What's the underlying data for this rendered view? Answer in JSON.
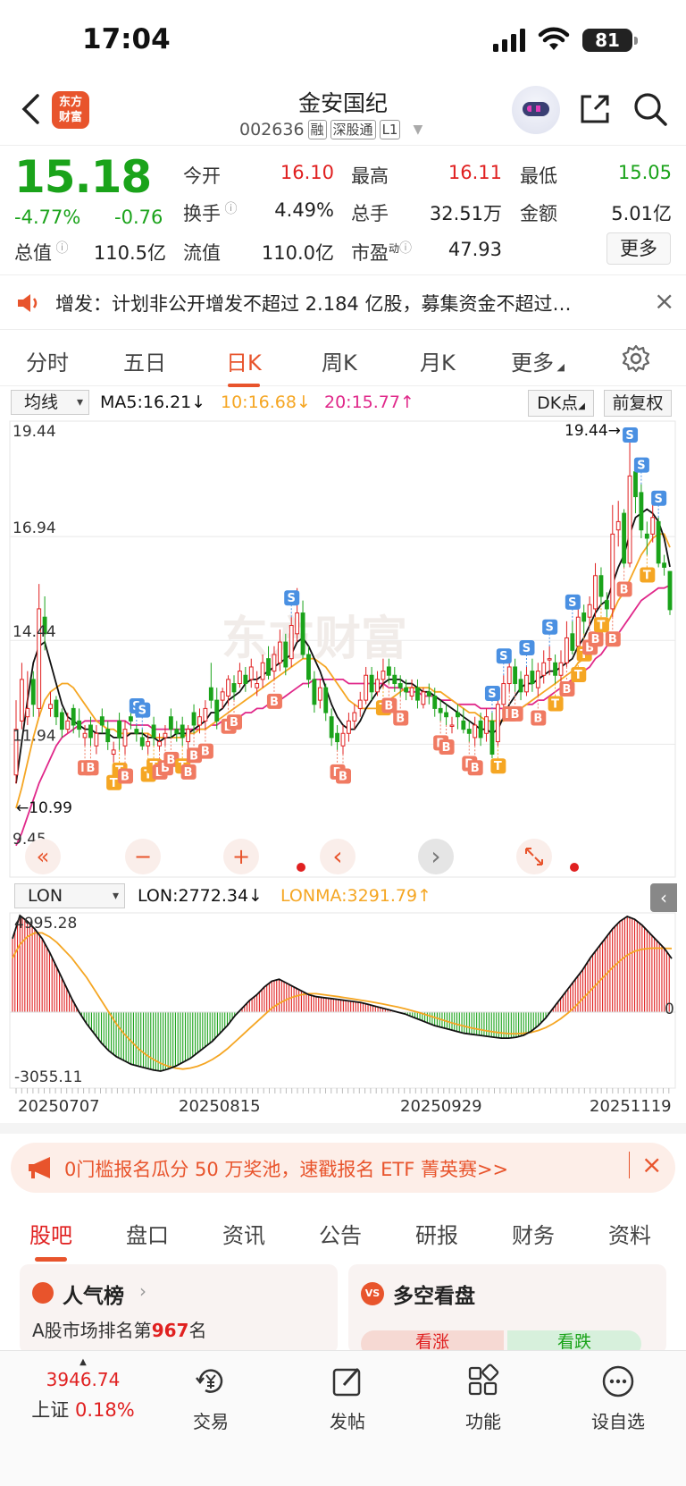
{
  "status": {
    "time": "17:04",
    "battery": "81"
  },
  "header": {
    "logo_text": "东方\n财富",
    "name": "金安国纪",
    "code": "002636",
    "tags": [
      "融",
      "深股通",
      "L1"
    ]
  },
  "quote": {
    "price": "15.18",
    "pct": "-4.77%",
    "chg": "-0.76",
    "open_label": "今开",
    "open": "16.10",
    "high_label": "最高",
    "high": "16.11",
    "low_label": "最低",
    "low": "15.05",
    "turnover_label": "换手",
    "turnover": "4.49%",
    "volume_label": "总手",
    "volume": "32.51万",
    "amount_label": "金额",
    "amount": "5.01亿",
    "mcap_label": "总值",
    "mcap": "110.5亿",
    "float_label": "流值",
    "float": "110.0亿",
    "pe_label": "市盈",
    "pe_sup": "动",
    "pe": "47.93",
    "more": "更多"
  },
  "notice": {
    "text": "增发：计划非公开增发不超过 2.184 亿股，募集资金不超过…",
    "close": "×"
  },
  "tabs": [
    "分时",
    "五日",
    "日K",
    "周K",
    "月K",
    "更多"
  ],
  "active_tab": 2,
  "chart_bar": {
    "indicator": "均线",
    "ma5": "MA5:16.21↓",
    "ma10": "10:16.68↓",
    "ma20": "20:15.77↑",
    "dk": "DK点",
    "adjust": "前复权"
  },
  "colors": {
    "up": "#e02020",
    "down": "#1aa31a",
    "ma5": "#111111",
    "ma10": "#f5a623",
    "ma20": "#e0288a",
    "accent": "#e8542c"
  },
  "chart_data": [
    {
      "type": "candlestick",
      "y_labels": [
        "19.44",
        "16.94",
        "14.44",
        "11.94",
        "9.45"
      ],
      "ylim": [
        9.45,
        19.44
      ],
      "max_label": "19.44→",
      "min_label": "←10.99",
      "watermark": "东方财富",
      "close": [
        12.3,
        13.5,
        12.8,
        12.9,
        15.2,
        14.6,
        12.9,
        12.6,
        12.3,
        12.5,
        12.4,
        12.3,
        12.2,
        12.1,
        12.2,
        12.4,
        12.0,
        11.8,
        12.1,
        12.3,
        12.5,
        12.2,
        11.9,
        12.0,
        12.1,
        12.0,
        12.2,
        12.3,
        12.2,
        12.1,
        12.3,
        12.4,
        12.6,
        12.8,
        13.0,
        12.5,
        13.2,
        13.5,
        13.2,
        13.7,
        13.4,
        13.8,
        13.4,
        13.9,
        13.6,
        14.1,
        14.4,
        13.8,
        14.8,
        15.1,
        14.1,
        13.5,
        12.9,
        13.3,
        12.7,
        12.1,
        12.0,
        12.2,
        12.5,
        12.7,
        13.0,
        13.6,
        13.2,
        13.5,
        13.7,
        13.6,
        13.4,
        13.3,
        13.2,
        13.3,
        13.0,
        13.2,
        13.1,
        12.8,
        12.7,
        12.6,
        12.4,
        12.6,
        12.3,
        12.2,
        12.4,
        12.1,
        12.6,
        11.7,
        12.9,
        13.4,
        13.8,
        13.4,
        13.2,
        13.6,
        13.4,
        13.7,
        13.9,
        14.0,
        13.6,
        13.9,
        14.5,
        14.2,
        15.0,
        14.9,
        15.3,
        16.0,
        15.5,
        15.2,
        17.0,
        17.3,
        16.3,
        18.4,
        17.9,
        17.1,
        16.9,
        17.4,
        16.3,
        16.2,
        15.18
      ],
      "open": [
        11.2,
        12.5,
        12.6,
        13.5,
        12.8,
        15.0,
        12.8,
        13.0,
        12.7,
        12.3,
        12.8,
        12.5,
        12.1,
        12.4,
        11.9,
        12.6,
        12.3,
        11.7,
        12.5,
        11.9,
        12.6,
        12.3,
        12.1,
        11.9,
        12.4,
        11.9,
        12.1,
        12.6,
        12.3,
        12.4,
        12.0,
        12.7,
        12.4,
        12.5,
        13.3,
        13.0,
        13.0,
        13.1,
        13.4,
        13.4,
        13.6,
        13.5,
        13.3,
        13.5,
        14.0,
        13.7,
        13.9,
        14.4,
        14.0,
        14.6,
        15.1,
        14.1,
        13.5,
        13.0,
        13.3,
        12.6,
        12.2,
        11.9,
        12.2,
        12.5,
        12.8,
        13.0,
        13.6,
        13.2,
        13.5,
        13.8,
        13.6,
        13.4,
        13.3,
        13.1,
        13.3,
        12.9,
        13.2,
        13.1,
        12.8,
        12.7,
        12.4,
        12.7,
        12.5,
        12.3,
        12.1,
        12.5,
        12.2,
        12.5,
        12.0,
        12.9,
        13.4,
        13.8,
        13.5,
        13.2,
        13.7,
        13.3,
        13.6,
        14.0,
        13.9,
        13.6,
        13.9,
        14.6,
        14.3,
        15.1,
        15.0,
        15.2,
        16.0,
        15.4,
        15.2,
        17.1,
        17.5,
        16.3,
        18.5,
        18.0,
        17.0,
        17.0,
        17.3,
        16.3,
        16.1
      ],
      "high": [
        13.0,
        13.9,
        13.7,
        13.7,
        15.8,
        15.5,
        13.2,
        13.1,
        12.8,
        12.7,
        12.9,
        12.8,
        12.4,
        12.6,
        12.4,
        12.8,
        12.5,
        12.0,
        12.7,
        12.5,
        12.8,
        12.4,
        12.3,
        12.2,
        12.6,
        12.2,
        12.4,
        12.8,
        12.5,
        12.6,
        12.4,
        12.9,
        12.8,
        13.0,
        13.9,
        13.3,
        13.3,
        13.6,
        13.6,
        13.9,
        13.8,
        14.0,
        13.7,
        14.1,
        14.3,
        14.3,
        14.7,
        14.6,
        15.0,
        15.7,
        15.4,
        14.3,
        13.7,
        13.5,
        13.4,
        12.8,
        12.4,
        12.4,
        12.7,
        12.9,
        13.2,
        13.8,
        13.8,
        13.7,
        14.0,
        14.0,
        13.8,
        13.6,
        13.5,
        13.5,
        13.5,
        13.3,
        13.4,
        13.3,
        13.0,
        12.9,
        12.6,
        12.9,
        12.8,
        12.5,
        12.6,
        12.7,
        12.8,
        12.7,
        13.1,
        13.6,
        14.0,
        14.0,
        13.7,
        13.8,
        14.0,
        13.9,
        14.2,
        14.3,
        14.1,
        14.2,
        14.9,
        14.9,
        15.5,
        15.3,
        15.5,
        16.3,
        16.2,
        15.6,
        17.7,
        17.8,
        17.6,
        19.44,
        18.6,
        18.2,
        17.3,
        17.7,
        17.4,
        16.5,
        16.11
      ],
      "low": [
        10.99,
        12.3,
        12.4,
        12.6,
        12.6,
        14.2,
        12.6,
        12.4,
        12.1,
        12.2,
        12.2,
        12.1,
        11.9,
        11.9,
        11.7,
        12.2,
        11.8,
        11.5,
        11.8,
        11.7,
        12.3,
        12.0,
        11.8,
        11.7,
        11.9,
        11.8,
        11.9,
        12.1,
        12.0,
        11.9,
        11.8,
        12.2,
        12.2,
        12.3,
        12.8,
        12.3,
        12.8,
        12.9,
        13.0,
        13.3,
        13.2,
        13.3,
        13.1,
        13.3,
        13.5,
        13.5,
        13.7,
        13.6,
        13.8,
        14.4,
        14.0,
        13.3,
        12.7,
        12.8,
        12.5,
        11.9,
        11.8,
        11.7,
        12.0,
        12.3,
        12.6,
        12.9,
        13.0,
        13.1,
        13.3,
        13.4,
        13.2,
        13.1,
        13.0,
        13.0,
        12.8,
        12.8,
        12.9,
        12.6,
        12.5,
        12.4,
        12.2,
        12.3,
        12.2,
        12.0,
        11.9,
        11.9,
        12.0,
        11.6,
        11.9,
        12.7,
        13.2,
        13.2,
        13.0,
        13.1,
        13.2,
        13.1,
        13.4,
        13.6,
        13.4,
        13.4,
        13.8,
        14.1,
        14.1,
        14.6,
        14.8,
        15.0,
        15.3,
        15.0,
        15.0,
        16.7,
        16.2,
        16.2,
        17.5,
        16.9,
        16.5,
        16.8,
        16.2,
        16.0,
        15.05
      ],
      "ma5": [
        11.0,
        12.0,
        13.0,
        13.9,
        14.3,
        14.4,
        13.9,
        13.4,
        12.9,
        12.6,
        12.5,
        12.4,
        12.3,
        12.3,
        12.2,
        12.2,
        12.2,
        12.1,
        12.1,
        12.1,
        12.2,
        12.2,
        12.2,
        12.1,
        12.1,
        12.0,
        12.1,
        12.1,
        12.2,
        12.2,
        12.2,
        12.3,
        12.4,
        12.5,
        12.7,
        12.7,
        12.8,
        13.0,
        13.1,
        13.2,
        13.4,
        13.5,
        13.5,
        13.6,
        13.7,
        13.8,
        13.9,
        14.0,
        14.1,
        14.4,
        14.5,
        14.3,
        14.0,
        13.7,
        13.3,
        12.9,
        12.6,
        12.4,
        12.3,
        12.3,
        12.5,
        12.8,
        13.0,
        13.2,
        13.4,
        13.5,
        13.5,
        13.5,
        13.4,
        13.4,
        13.3,
        13.2,
        13.2,
        13.1,
        13.0,
        12.9,
        12.8,
        12.7,
        12.6,
        12.5,
        12.4,
        12.3,
        12.3,
        12.2,
        12.3,
        12.6,
        12.9,
        13.1,
        13.3,
        13.4,
        13.4,
        13.5,
        13.6,
        13.7,
        13.7,
        13.8,
        13.9,
        14.0,
        14.3,
        14.5,
        14.8,
        15.1,
        15.3,
        15.4,
        15.8,
        16.2,
        16.5,
        17.0,
        17.4,
        17.5,
        17.6,
        17.5,
        17.3,
        16.9,
        16.21
      ],
      "ma10": [
        10.4,
        10.9,
        11.5,
        12.1,
        12.6,
        13.0,
        13.2,
        13.3,
        13.4,
        13.4,
        13.3,
        13.1,
        12.9,
        12.7,
        12.5,
        12.4,
        12.3,
        12.3,
        12.2,
        12.2,
        12.2,
        12.2,
        12.2,
        12.2,
        12.1,
        12.1,
        12.1,
        12.1,
        12.1,
        12.1,
        12.2,
        12.2,
        12.3,
        12.3,
        12.4,
        12.5,
        12.6,
        12.7,
        12.8,
        12.9,
        13.0,
        13.1,
        13.2,
        13.3,
        13.4,
        13.5,
        13.6,
        13.7,
        13.8,
        13.9,
        14.0,
        14.0,
        14.0,
        13.9,
        13.8,
        13.6,
        13.4,
        13.2,
        13.0,
        12.9,
        12.8,
        12.8,
        12.8,
        12.8,
        12.9,
        13.0,
        13.1,
        13.2,
        13.3,
        13.3,
        13.3,
        13.3,
        13.3,
        13.2,
        13.2,
        13.1,
        13.0,
        12.9,
        12.8,
        12.7,
        12.7,
        12.6,
        12.5,
        12.5,
        12.5,
        12.5,
        12.6,
        12.7,
        12.8,
        12.9,
        13.0,
        13.1,
        13.2,
        13.3,
        13.4,
        13.5,
        13.6,
        13.7,
        13.9,
        14.0,
        14.2,
        14.4,
        14.6,
        14.8,
        15.1,
        15.4,
        15.6,
        15.9,
        16.2,
        16.5,
        16.7,
        16.9,
        17.0,
        17.0,
        16.68
      ],
      "ma20": [
        9.5,
        9.8,
        10.2,
        10.6,
        11.0,
        11.3,
        11.6,
        11.9,
        12.1,
        12.2,
        12.3,
        12.4,
        12.5,
        12.5,
        12.5,
        12.5,
        12.5,
        12.5,
        12.5,
        12.5,
        12.4,
        12.4,
        12.4,
        12.4,
        12.3,
        12.3,
        12.3,
        12.3,
        12.3,
        12.3,
        12.3,
        12.3,
        12.3,
        12.3,
        12.4,
        12.4,
        12.5,
        12.5,
        12.6,
        12.6,
        12.7,
        12.7,
        12.8,
        12.8,
        12.9,
        13.0,
        13.0,
        13.1,
        13.2,
        13.3,
        13.4,
        13.4,
        13.5,
        13.5,
        13.5,
        13.5,
        13.5,
        13.5,
        13.4,
        13.4,
        13.4,
        13.4,
        13.4,
        13.4,
        13.4,
        13.3,
        13.3,
        13.3,
        13.2,
        13.2,
        13.2,
        13.1,
        13.1,
        13.1,
        13.0,
        13.0,
        13.0,
        12.9,
        12.9,
        12.9,
        12.9,
        12.8,
        12.8,
        12.8,
        12.8,
        12.8,
        12.8,
        12.8,
        12.8,
        12.9,
        12.9,
        13.0,
        13.0,
        13.1,
        13.2,
        13.3,
        13.4,
        13.5,
        13.6,
        13.7,
        13.8,
        14.0,
        14.1,
        14.3,
        14.4,
        14.6,
        14.8,
        15.0,
        15.2,
        15.4,
        15.5,
        15.6,
        15.7,
        15.7,
        15.77
      ],
      "signals": [
        {
          "i": 4,
          "s": "-"
        },
        {
          "i": 12,
          "s": "B"
        },
        {
          "i": 13,
          "s": "B"
        },
        {
          "i": 17,
          "s": "T"
        },
        {
          "i": 18,
          "s": "T"
        },
        {
          "i": 19,
          "s": "B"
        },
        {
          "i": 21,
          "s": "S"
        },
        {
          "i": 22,
          "s": "S"
        },
        {
          "i": 23,
          "s": "T"
        },
        {
          "i": 24,
          "s": "T"
        },
        {
          "i": 25,
          "s": "B"
        },
        {
          "i": 26,
          "s": "B"
        },
        {
          "i": 27,
          "s": "B"
        },
        {
          "i": 29,
          "s": "T"
        },
        {
          "i": 30,
          "s": "B"
        },
        {
          "i": 31,
          "s": "B"
        },
        {
          "i": 33,
          "s": "B"
        },
        {
          "i": 37,
          "s": "B"
        },
        {
          "i": 38,
          "s": "B"
        },
        {
          "i": 45,
          "s": "B"
        },
        {
          "i": 48,
          "s": "S"
        },
        {
          "i": 56,
          "s": "B"
        },
        {
          "i": 57,
          "s": "B"
        },
        {
          "i": 64,
          "s": "T"
        },
        {
          "i": 65,
          "s": "B"
        },
        {
          "i": 67,
          "s": "B"
        },
        {
          "i": 74,
          "s": "B"
        },
        {
          "i": 75,
          "s": "B"
        },
        {
          "i": 79,
          "s": "B"
        },
        {
          "i": 80,
          "s": "B"
        },
        {
          "i": 83,
          "s": "S"
        },
        {
          "i": 84,
          "s": "T"
        },
        {
          "i": 85,
          "s": "S"
        },
        {
          "i": 86,
          "s": "B"
        },
        {
          "i": 87,
          "s": "B"
        },
        {
          "i": 89,
          "s": "S"
        },
        {
          "i": 91,
          "s": "B"
        },
        {
          "i": 93,
          "s": "S"
        },
        {
          "i": 94,
          "s": "T"
        },
        {
          "i": 96,
          "s": "B"
        },
        {
          "i": 97,
          "s": "S"
        },
        {
          "i": 98,
          "s": "T"
        },
        {
          "i": 99,
          "s": "T"
        },
        {
          "i": 100,
          "s": "B"
        },
        {
          "i": 101,
          "s": "B"
        },
        {
          "i": 102,
          "s": "T"
        },
        {
          "i": 104,
          "s": "B"
        },
        {
          "i": 106,
          "s": "B"
        },
        {
          "i": 107,
          "s": "S"
        },
        {
          "i": 109,
          "s": "S"
        },
        {
          "i": 110,
          "s": "T"
        },
        {
          "i": 112,
          "s": "S"
        }
      ]
    },
    {
      "type": "bar",
      "indicator": "LON",
      "lon_label": "LON:2772.34↓",
      "lonma_label": "LONMA:3291.79↑",
      "y_labels": [
        "4995.28",
        "-3055.11",
        "0"
      ],
      "ylim": [
        -3055.11,
        4995.28
      ],
      "x_labels": [
        "20250707",
        "20250815",
        "20250929",
        "20251119"
      ],
      "lon": [
        3800,
        4995,
        4700,
        4300,
        3800,
        3100,
        2300,
        1500,
        700,
        0,
        -600,
        -1100,
        -1600,
        -2000,
        -2300,
        -2500,
        -2700,
        -2800,
        -2900,
        -3000,
        -3055,
        -2950,
        -2800,
        -2600,
        -2400,
        -2100,
        -1800,
        -1500,
        -1100,
        -700,
        -200,
        200,
        600,
        900,
        1300,
        1600,
        1700,
        1500,
        1300,
        1100,
        900,
        800,
        750,
        700,
        650,
        600,
        550,
        500,
        400,
        300,
        200,
        100,
        0,
        -100,
        -250,
        -400,
        -550,
        -700,
        -800,
        -900,
        -1000,
        -1100,
        -1150,
        -1200,
        -1250,
        -1300,
        -1350,
        -1350,
        -1300,
        -1200,
        -1000,
        -700,
        -300,
        200,
        700,
        1200,
        1700,
        2200,
        2800,
        3300,
        3800,
        4300,
        4700,
        4950,
        4800,
        4500,
        4100,
        3700,
        3300,
        2772
      ],
      "lonma": [
        2800,
        3500,
        3900,
        4100,
        4100,
        3900,
        3600,
        3200,
        2800,
        2300,
        1800,
        1200,
        600,
        0,
        -600,
        -1100,
        -1500,
        -1900,
        -2200,
        -2450,
        -2650,
        -2800,
        -2900,
        -2950,
        -2900,
        -2800,
        -2650,
        -2450,
        -2200,
        -1900,
        -1550,
        -1200,
        -850,
        -500,
        -150,
        200,
        450,
        650,
        800,
        900,
        950,
        950,
        900,
        850,
        800,
        740,
        680,
        620,
        560,
        490,
        420,
        340,
        260,
        170,
        70,
        -40,
        -160,
        -280,
        -400,
        -520,
        -630,
        -730,
        -820,
        -900,
        -970,
        -1030,
        -1080,
        -1110,
        -1120,
        -1100,
        -1050,
        -950,
        -800,
        -600,
        -350,
        -50,
        300,
        700,
        1100,
        1500,
        1900,
        2300,
        2650,
        2950,
        3150,
        3250,
        3300,
        3310,
        3300,
        3291
      ]
    }
  ],
  "chart_controls": {
    "left_double": "«",
    "minus": "−",
    "plus": "+",
    "prev": "‹",
    "next": "›"
  },
  "lon_bar": {
    "indicator": "LON"
  },
  "promo": {
    "text": "0门槛报名瓜分 50 万奖池，速戳报名 ETF 菁英赛>>",
    "close": "×"
  },
  "bottom_tabs": [
    "股吧",
    "盘口",
    "资讯",
    "公告",
    "研报",
    "财务",
    "资料"
  ],
  "cards": {
    "rank_title": "人气榜",
    "rank_text_pre": "A股市场排名第",
    "rank_num": "967",
    "rank_text_post": "名",
    "bull_title": "多空看盘",
    "bull_up": "看涨",
    "bull_down": "看跌"
  },
  "bottombar": {
    "index_value": "3946.74",
    "index_name": "上证",
    "index_pct": "0.18%",
    "trade": "交易",
    "post": "发帖",
    "func": "功能",
    "fav": "设自选"
  }
}
